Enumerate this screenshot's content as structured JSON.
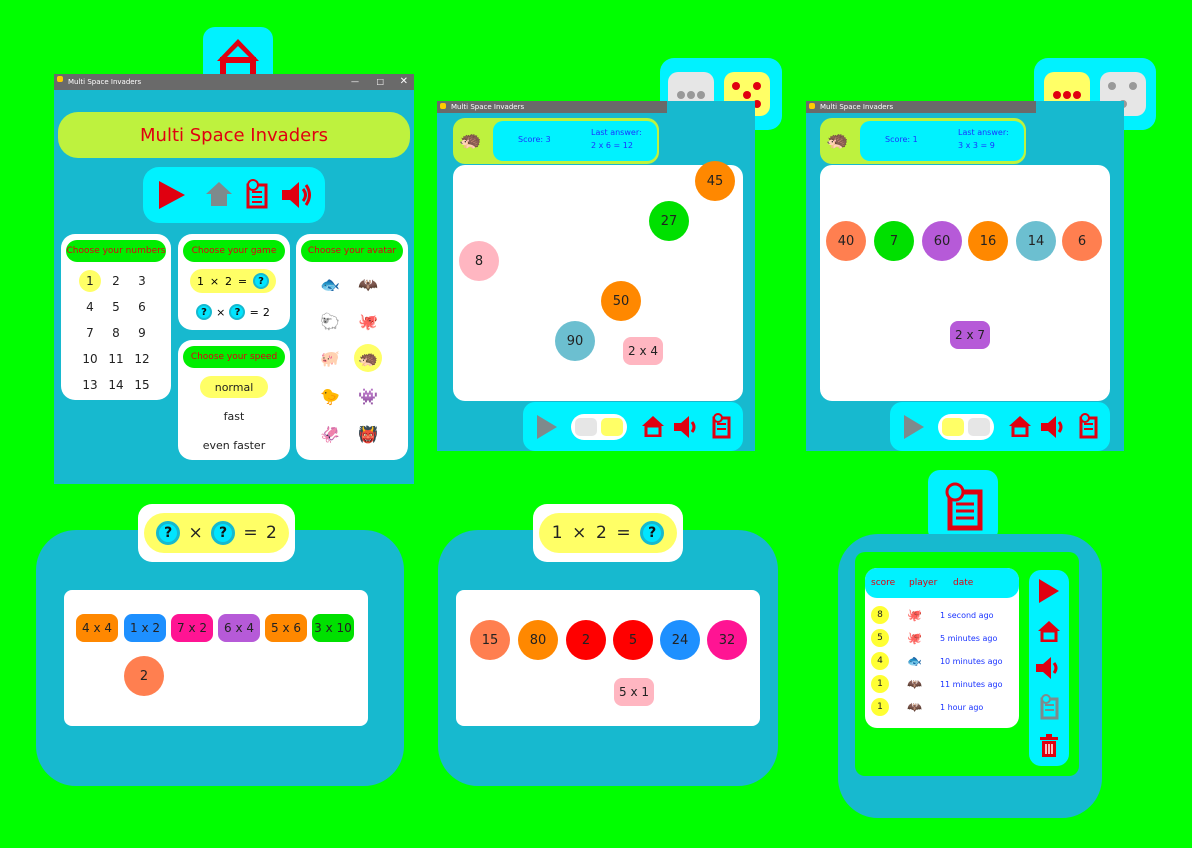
{
  "main_window": {
    "title": "Multi Space Invaders",
    "banner_title": "Multi Space Invaders",
    "numbers_header": "Choose your numbers",
    "numbers": [
      "1",
      "2",
      "3",
      "4",
      "5",
      "6",
      "7",
      "8",
      "9",
      "10",
      "11",
      "12",
      "13",
      "14",
      "15"
    ],
    "game_header": "Choose your game",
    "game_option_1": [
      "1",
      "×",
      "2",
      "=",
      "?"
    ],
    "game_option_2": [
      "?",
      "×",
      "?",
      "=",
      "2"
    ],
    "speed_header": "Choose your speed",
    "speeds": [
      "normal",
      "fast",
      "even faster"
    ],
    "avatar_header": "Choose your avatar",
    "window_controls": [
      "—",
      "□",
      "✕"
    ]
  },
  "game_window_1": {
    "title": "Multi Space Invaders",
    "score_label": "Score: 3",
    "last_answer_label": "Last answer:",
    "last_answer_value": "2 x 6 = 12",
    "bubbles": [
      "45",
      "27",
      "8",
      "50",
      "90"
    ],
    "question": "2 x 4"
  },
  "game_window_2": {
    "title": "Multi Space Invaders",
    "score_label": "Score: 1",
    "last_answer_label": "Last answer:",
    "last_answer_value": "3 x 3 = 9",
    "bubbles": [
      "40",
      "7",
      "60",
      "16",
      "14",
      "6"
    ],
    "question": "2 x 7"
  },
  "mode_card_1": {
    "header": [
      "?",
      "×",
      "?",
      "=",
      "2"
    ],
    "tiles": [
      "4 x 4",
      "1 x 2",
      "7 x 2",
      "6 x 4",
      "5 x 6",
      "3 x 10"
    ],
    "answer": "2"
  },
  "mode_card_2": {
    "header": [
      "1",
      "×",
      "2",
      "=",
      "?"
    ],
    "bubbles": [
      "15",
      "80",
      "2",
      "5",
      "24",
      "32"
    ],
    "question": "5 x 1"
  },
  "history": {
    "col_score": "score",
    "col_player": "player",
    "col_date": "date",
    "rows": [
      {
        "score": "8",
        "avatar": "octopus",
        "date": "1 second ago"
      },
      {
        "score": "5",
        "avatar": "octopus",
        "date": "5 minutes ago"
      },
      {
        "score": "4",
        "avatar": "fish",
        "date": "10 minutes ago"
      },
      {
        "score": "1",
        "avatar": "bat",
        "date": "11 minutes ago"
      },
      {
        "score": "1",
        "avatar": "bat",
        "date": "1 hour ago"
      }
    ]
  },
  "colors": {
    "background": "#00ff00",
    "cyan": "#00f2ff",
    "teal": "#17b9cf",
    "accent_red": "#e00010",
    "highlight_yellow": "#ffff66"
  }
}
